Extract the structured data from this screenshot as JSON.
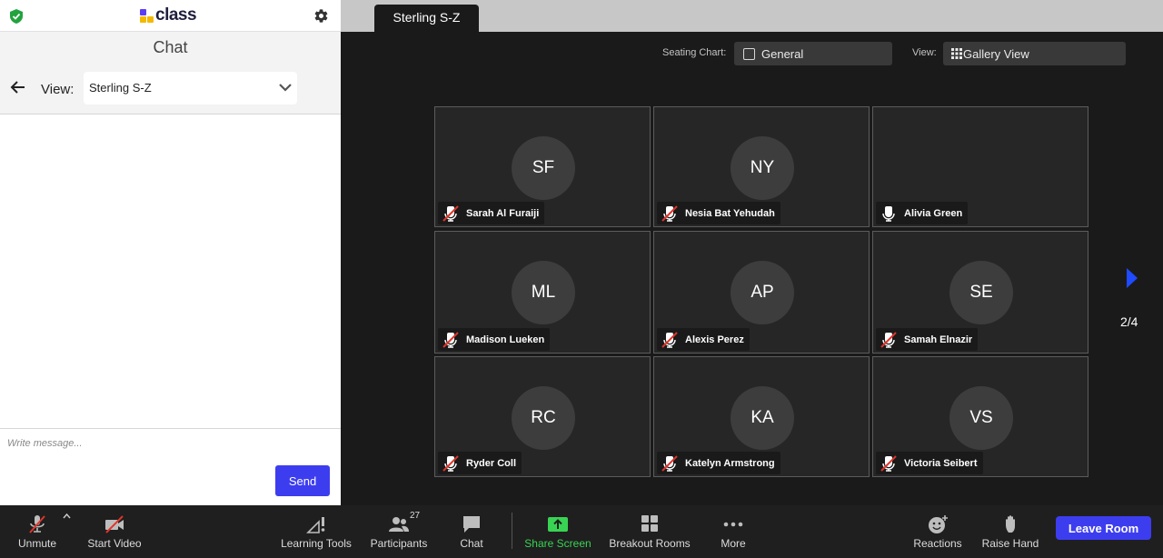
{
  "sidebar": {
    "logo_text": "class",
    "chat_title": "Chat",
    "view_label": "View:",
    "view_value": "Sterling S-Z",
    "compose_placeholder": "Write message...",
    "send_label": "Send"
  },
  "main": {
    "active_tab": "Sterling S-Z",
    "seating_chart_label": "Seating Chart:",
    "seating_chart_value": "General",
    "view_mode_label": "View:",
    "view_mode_value": "Gallery View",
    "page_indicator": "2/4",
    "participants": [
      {
        "initials": "SF",
        "name": "Sarah Al Furaiji",
        "muted": true
      },
      {
        "initials": "NY",
        "name": "Nesia Bat Yehudah",
        "muted": true
      },
      {
        "initials": "",
        "name": "Alivia Green",
        "muted": false
      },
      {
        "initials": "ML",
        "name": "Madison Lueken",
        "muted": true
      },
      {
        "initials": "AP",
        "name": "Alexis Perez",
        "muted": true
      },
      {
        "initials": "SE",
        "name": "Samah Elnazir",
        "muted": true
      },
      {
        "initials": "RC",
        "name": "Ryder Coll",
        "muted": true
      },
      {
        "initials": "KA",
        "name": "Katelyn Armstrong",
        "muted": true
      },
      {
        "initials": "VS",
        "name": "Victoria Seibert",
        "muted": true
      }
    ]
  },
  "toolbar": {
    "unmute": "Unmute",
    "start_video": "Start Video",
    "learning_tools": "Learning Tools",
    "participants": "Participants",
    "participants_count": "27",
    "chat": "Chat",
    "share_screen": "Share Screen",
    "breakout_rooms": "Breakout Rooms",
    "more": "More",
    "reactions": "Reactions",
    "raise_hand": "Raise Hand",
    "leave_room": "Leave Room"
  },
  "colors": {
    "accent": "#3d3df0",
    "share_green": "#39d353",
    "muted_red": "#e0352b",
    "shield_green": "#22a33d",
    "logo_yellow": "#f5b800",
    "logo_purple": "#5b3df5"
  }
}
